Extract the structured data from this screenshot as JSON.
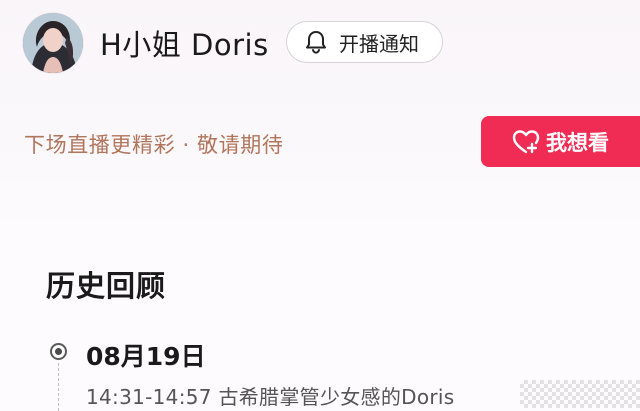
{
  "profile": {
    "name": "H小姐 Doris",
    "avatar_icon": "avatar-photo"
  },
  "notify_button": {
    "icon": "bell-icon",
    "label": "开播通知"
  },
  "promo": {
    "text": "下场直播更精彩 · 敬请期待"
  },
  "want_button": {
    "icon": "heart-plus-icon",
    "label": "我想看",
    "color": "#f02c54"
  },
  "history": {
    "title": "历史回顾",
    "entries": [
      {
        "date": "08月19日",
        "session": "14:31-14:57 古希腊掌管少女感的Doris"
      }
    ]
  },
  "colors": {
    "promo_text": "#b0755a",
    "accent": "#f02c54"
  }
}
